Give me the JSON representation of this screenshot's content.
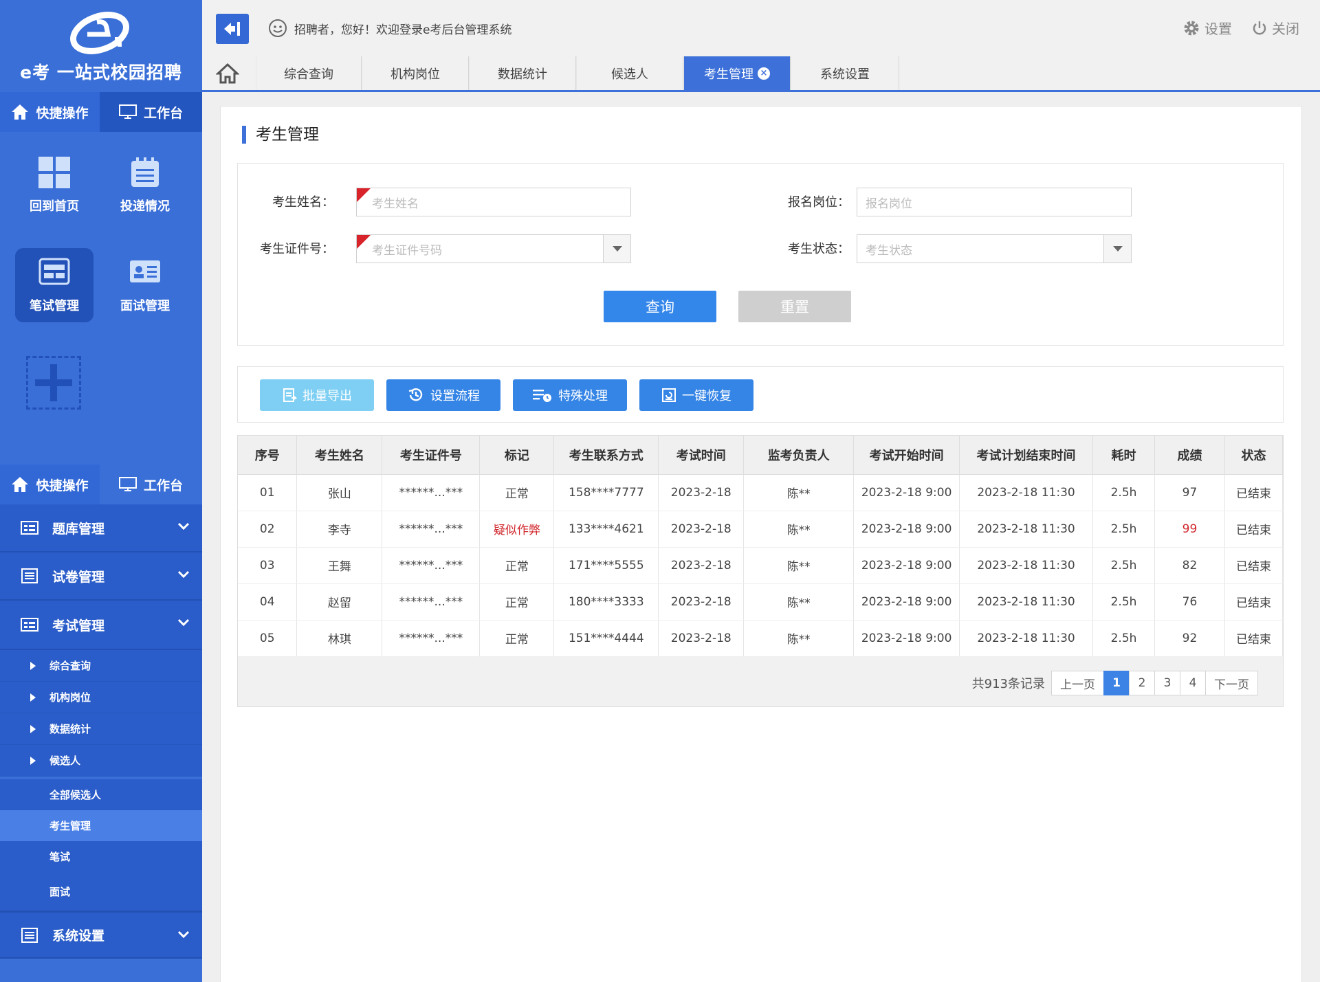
{
  "sidebar": {
    "brand": "e考 一站式校园招聘",
    "tabs": [
      {
        "label": "快捷操作"
      },
      {
        "label": "工作台"
      }
    ],
    "quick_items": [
      {
        "label": "回到首页",
        "icon": "grid-icon"
      },
      {
        "label": "投递情况",
        "icon": "clipboard-icon"
      },
      {
        "label": "笔试管理",
        "icon": "exam-icon"
      },
      {
        "label": "面试管理",
        "icon": "id-card-icon"
      }
    ],
    "tabs2": [
      {
        "label": "快捷操作"
      },
      {
        "label": "工作台"
      }
    ],
    "menu": [
      {
        "label": "题库管理"
      },
      {
        "label": "试卷管理"
      },
      {
        "label": "考试管理"
      }
    ],
    "subs": [
      {
        "label": "综合查询"
      },
      {
        "label": "机构岗位"
      },
      {
        "label": "数据统计"
      },
      {
        "label": "候选人"
      }
    ],
    "leaves": [
      {
        "label": "全部候选人"
      },
      {
        "label": "考生管理"
      },
      {
        "label": "笔试"
      },
      {
        "label": "面试"
      }
    ],
    "last_menu": {
      "label": "系统设置"
    }
  },
  "topbar": {
    "greeting": "招聘者，您好！欢迎登录e考后台管理系统",
    "settings": "设置",
    "close": "关闭"
  },
  "tabs": [
    {
      "label": "综合查询"
    },
    {
      "label": "机构岗位"
    },
    {
      "label": "数据统计"
    },
    {
      "label": "候选人"
    },
    {
      "label": "考生管理",
      "active": true
    },
    {
      "label": "系统设置"
    }
  ],
  "page": {
    "title": "考生管理",
    "filters": {
      "name_label": "考生姓名：",
      "name_placeholder": "考生姓名",
      "post_label": "报名岗位：",
      "post_placeholder": "报名岗位",
      "id_label": "考生证件号：",
      "id_placeholder": "考生证件号码",
      "status_label": "考生状态：",
      "status_placeholder": "考生状态"
    },
    "query_btn": "查询",
    "reset_btn": "重置",
    "toolbar": [
      {
        "label": "批量导出",
        "color": "#7ecff3"
      },
      {
        "label": "设置流程",
        "color": "#3585e6"
      },
      {
        "label": "特殊处理",
        "color": "#3585e6"
      },
      {
        "label": "一键恢复",
        "color": "#3585e6"
      }
    ],
    "table": {
      "headers": [
        "序号",
        "考生姓名",
        "考生证件号",
        "标记",
        "考生联系方式",
        "考试时间",
        "监考负责人",
        "考试开始时间",
        "考试计划结束时间",
        "耗时",
        "成绩",
        "状态"
      ],
      "rows": [
        [
          "01",
          "张山",
          "******...***",
          "正常",
          "158****7777",
          "2023-2-18",
          "陈**",
          "2023-2-18  9:00",
          "2023-2-18  11:30",
          "2.5h",
          "97",
          "已结束"
        ],
        [
          "02",
          "李寺",
          "******...***",
          "疑似作弊",
          "133****4621",
          "2023-2-18",
          "陈**",
          "2023-2-18  9:00",
          "2023-2-18  11:30",
          "2.5h",
          "99",
          "已结束"
        ],
        [
          "03",
          "王舞",
          "******...***",
          "正常",
          "171****5555",
          "2023-2-18",
          "陈**",
          "2023-2-18  9:00",
          "2023-2-18  11:30",
          "2.5h",
          "82",
          "已结束"
        ],
        [
          "04",
          "赵留",
          "******...***",
          "正常",
          "180****3333",
          "2023-2-18",
          "陈**",
          "2023-2-18  9:00",
          "2023-2-18  11:30",
          "2.5h",
          "76",
          "已结束"
        ],
        [
          "05",
          "林琪",
          "******...***",
          "正常",
          "151****4444",
          "2023-2-18",
          "陈**",
          "2023-2-18  9:00",
          "2023-2-18  11:30",
          "2.5h",
          "92",
          "已结束"
        ]
      ]
    },
    "pager": {
      "total": "共913条记录",
      "prev": "上一页",
      "pages": [
        "1",
        "2",
        "3",
        "4"
      ],
      "current": "1",
      "next": "下一页"
    }
  },
  "colors": {
    "sidebar": "#3a6fd8",
    "accent": "#3d71d9",
    "warning_text": "#d0262b"
  }
}
